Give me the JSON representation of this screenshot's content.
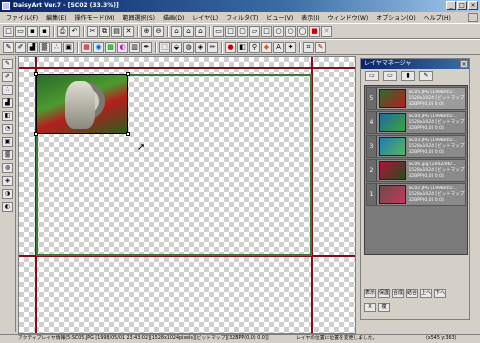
{
  "app": {
    "title": "DaisyArt Ver.7 - [SC02 (33.3%)]",
    "window_controls": [
      "_",
      "□",
      "×"
    ]
  },
  "menubar": {
    "items": [
      "ファイル(F)",
      "編集(E)",
      "操作モード(M)",
      "範囲選択(S)",
      "描画(D)",
      "レイヤ(L)",
      "フィルタ(T)",
      "ビュー(V)",
      "表示(I)",
      "ウィンドウ(W)",
      "オプション(O)",
      "ヘルプ(H)"
    ]
  },
  "toolbar1": {
    "tools": [
      "new",
      "open",
      "save",
      "save-as",
      "print",
      "undo",
      "cut",
      "copy",
      "paste",
      "clear",
      "zoom-in",
      "zoom-out",
      "fit",
      "full",
      "rect-select",
      "rect",
      "round-rect",
      "ellipse",
      "ellipse2",
      "circle",
      "lasso",
      "delete",
      "cancel"
    ]
  },
  "toolbar2": {
    "tools": [
      "brush",
      "airbrush",
      "fill",
      "gradient",
      "spray",
      "stamp",
      "palette",
      "rainbow",
      "swatch",
      "layer",
      "pen",
      "eraser",
      "smudge",
      "blur",
      "sharpen",
      "pencil",
      "eyedropper",
      "color",
      "pattern",
      "text",
      "magic",
      "crop"
    ]
  },
  "left_tools": [
    "pencil",
    "brush",
    "airbrush",
    "fill",
    "eraser",
    "smudge",
    "stamp",
    "gradient",
    "blur",
    "sharpen",
    "dodge",
    "burn"
  ],
  "canvas": {
    "zoom": "33.3%"
  },
  "layer_panel": {
    "title": "レイヤマネージャ",
    "close_label": "×",
    "toolbar": [
      "new",
      "duplicate",
      "delete",
      "settings"
    ],
    "layers": [
      {
        "index": "5",
        "name": "SC05.JPG [1998/05/...",
        "size": "1528x1024 [ビットマップ]",
        "bpp": "32BPP(0,0) 0.0]",
        "thumb_colors": [
          "#2f6a2f",
          "#b51e1e"
        ],
        "selected": true
      },
      {
        "index": "4",
        "name": "SC04.JPG [1998/05/...",
        "size": "1528x1024 [ビットマップ]",
        "bpp": "32BPP(0,0) 0.0]",
        "thumb_colors": [
          "#1f6aa0",
          "#3ca33c"
        ],
        "selected": false
      },
      {
        "index": "3",
        "name": "SC03.JPG [1998/05/...",
        "size": "1528x1024 [ビットマップ]",
        "bpp": "32BPP(0,0) 0.0]",
        "thumb_colors": [
          "#1d7bb8",
          "#59b65a"
        ],
        "selected": false
      },
      {
        "index": "2",
        "name": "SC06.jpg [2002/06/...",
        "size": "1528x1024 [ビットマップ]",
        "bpp": "32BPP(0,0) 0.0]",
        "thumb_colors": [
          "#b0123a",
          "#264d1e"
        ],
        "selected": false
      },
      {
        "index": "1",
        "name": "SC02.JPG [1998/05/...",
        "size": "1528x1024 [ビットマップ]",
        "bpp": "32BPP(0,0) 0.0]",
        "thumb_colors": [
          "#6a4a4a",
          "#c33a5a"
        ],
        "selected": false
      }
    ],
    "bottom_buttons": [
      "表示",
      "保護",
      "合成",
      "結合",
      "上へ",
      "下へ"
    ],
    "bottom_buttons2": [
      "X",
      "複"
    ]
  },
  "statusbar": {
    "left": "アクティブレイヤ情報(5:SC05.JPG [1998/05/01 23:43:02][1528x1024pixels][ビットマップ][32BPP(0,0) 0.0]]",
    "middle": "レイヤの位置に位置を変更しました。",
    "right": "(x545 y:363)"
  }
}
